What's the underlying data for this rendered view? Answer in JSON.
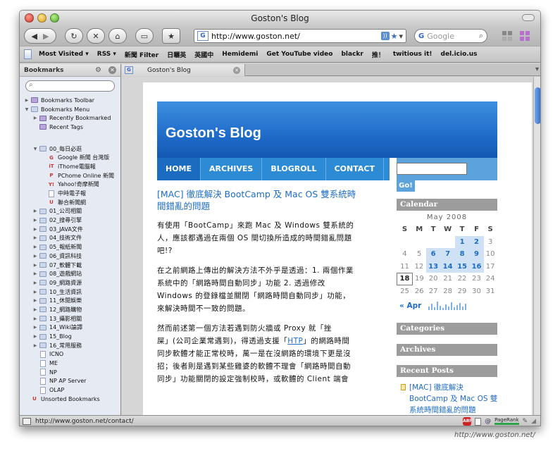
{
  "window": {
    "title": "Goston's Blog"
  },
  "nav": {
    "url": "http://www.goston.net/",
    "search_placeholder": "Google",
    "url_favicon": "G",
    "search_engine_icon": "G"
  },
  "bookmarks_toolbar": {
    "items": [
      "Most Visited ▾",
      "RSS ▾",
      "新聞 Filter",
      "日曬英",
      "英國中",
      "Hemidemi",
      "Get YouTube video",
      "blackr",
      "推！",
      "twitious it!",
      "del.icio.us"
    ]
  },
  "sidebar": {
    "header": "Bookmarks",
    "tree": [
      {
        "label": "Bookmarks Toolbar",
        "level": 0,
        "type": "folder-special",
        "state": "collapsed"
      },
      {
        "label": "Bookmarks Menu",
        "level": 0,
        "type": "folder",
        "state": "expanded"
      },
      {
        "label": "Recently Bookmarked",
        "level": 1,
        "type": "folder-special",
        "state": "collapsed"
      },
      {
        "label": "Recent Tags",
        "level": 1,
        "type": "folder-special",
        "state": "none"
      },
      {
        "label": "00_每日必逛",
        "level": 1,
        "type": "folder",
        "state": "expanded",
        "gap": true
      },
      {
        "label": "Google 新聞 台灣版",
        "level": 2,
        "type": "fav",
        "icon": "G"
      },
      {
        "label": "iThome電腦報",
        "level": 2,
        "type": "fav",
        "icon": "iT"
      },
      {
        "label": "PChome Online 新聞",
        "level": 2,
        "type": "fav",
        "icon": "P"
      },
      {
        "label": "Yahoo!奇摩新聞",
        "level": 2,
        "type": "fav",
        "icon": "Y!"
      },
      {
        "label": "中時電子報",
        "level": 2,
        "type": "doc"
      },
      {
        "label": "聯合新聞網",
        "level": 2,
        "type": "fav",
        "icon": "U"
      },
      {
        "label": "01_公司相關",
        "level": 1,
        "type": "folder",
        "state": "collapsed"
      },
      {
        "label": "02_搜尋引擎",
        "level": 1,
        "type": "folder",
        "state": "collapsed"
      },
      {
        "label": "03_JAVA文件",
        "level": 1,
        "type": "folder",
        "state": "collapsed"
      },
      {
        "label": "04_技術文件",
        "level": 1,
        "type": "folder",
        "state": "collapsed"
      },
      {
        "label": "05_報紙新聞",
        "level": 1,
        "type": "folder",
        "state": "collapsed"
      },
      {
        "label": "06_資訊科技",
        "level": 1,
        "type": "folder",
        "state": "collapsed"
      },
      {
        "label": "07_軟體下載",
        "level": 1,
        "type": "folder",
        "state": "collapsed"
      },
      {
        "label": "08_遊戲網站",
        "level": 1,
        "type": "folder",
        "state": "collapsed"
      },
      {
        "label": "09_網路資源",
        "level": 1,
        "type": "folder",
        "state": "collapsed"
      },
      {
        "label": "10_生活資訊",
        "level": 1,
        "type": "folder",
        "state": "collapsed"
      },
      {
        "label": "11_休閒娛樂",
        "level": 1,
        "type": "folder",
        "state": "collapsed"
      },
      {
        "label": "12_網路購物",
        "level": 1,
        "type": "folder",
        "state": "collapsed"
      },
      {
        "label": "13_攝影相關",
        "level": 1,
        "type": "folder",
        "state": "collapsed"
      },
      {
        "label": "14_Wiki論譚",
        "level": 1,
        "type": "folder",
        "state": "collapsed"
      },
      {
        "label": "15_Blog",
        "level": 1,
        "type": "folder",
        "state": "collapsed"
      },
      {
        "label": "16_常用服務",
        "level": 1,
        "type": "folder",
        "state": "collapsed"
      },
      {
        "label": "ICNO",
        "level": 1,
        "type": "doc"
      },
      {
        "label": "ME",
        "level": 1,
        "type": "doc"
      },
      {
        "label": "NP",
        "level": 1,
        "type": "doc"
      },
      {
        "label": "NP AP Server",
        "level": 1,
        "type": "doc"
      },
      {
        "label": "OLAP",
        "level": 1,
        "type": "doc"
      },
      {
        "label": "Unsorted Bookmarks",
        "level": 0,
        "type": "fav",
        "icon": "U"
      }
    ]
  },
  "tab": {
    "label": "Goston's Blog",
    "favicon": "G"
  },
  "status": {
    "url": "http://www.goston.net/contact/",
    "pagerank": "PageRank",
    "adblock_label": "ABP"
  },
  "watermark": "http://www.goston.net/",
  "blog": {
    "title": "Goston's Blog",
    "menu": [
      "HOME",
      "ARCHIVES",
      "BLOGROLL",
      "CONTACT"
    ],
    "go": "Go!",
    "post_title": [
      "[MAC] 徹底解決 BootCamp 及 Mac OS 雙系統時",
      "間錯亂的問題"
    ],
    "p1": [
      "有使用「BootCamp」來跑 Mac 及 Windows 雙系統的",
      "人，應該都遇過在兩個 OS 間切換所造成的時間錯亂問題",
      "吧!?"
    ],
    "p2": [
      "在之前網路上傳出的解決方法不外乎是透過：1. 兩個作業",
      "系統中的「網路時間自動同步」功能 2. 透過修改",
      "Windows 的登錄檔並關閉「網路時間自動同步」功能，",
      "來解決時間不一致的問題。"
    ],
    "p3_a": "然而前述第一個方法若遇到防火牆或 Proxy 就「挫",
    "p3_b1": "屎」(公司企業常遇到)，得透過支援「",
    "p3_link": "HTP",
    "p3_b2": "」的網路時間",
    "p3_rest": [
      "同步軟體才能正常校時，萬一是在沒網路的環境下更是沒",
      "招；後者則是遇到某些雞婆的軟體不理會「網路時間自動",
      "同步」功能關閉的設定強制校時，或軟體的 Client 端會"
    ],
    "calendar": {
      "heading": "Calendar",
      "month": "May 2008",
      "dow": [
        "S",
        "M",
        "T",
        "W",
        "T",
        "F",
        "S"
      ],
      "weeks": [
        [
          "",
          "",
          "",
          "",
          "1",
          "2",
          "3"
        ],
        [
          "4",
          "5",
          "6",
          "7",
          "8",
          "9",
          "10"
        ],
        [
          "11",
          "12",
          "13",
          "14",
          "15",
          "16",
          "17"
        ],
        [
          "18",
          "19",
          "20",
          "21",
          "22",
          "23",
          "24"
        ],
        [
          "25",
          "26",
          "27",
          "28",
          "29",
          "30",
          "31"
        ]
      ],
      "linked_days": [
        "1",
        "2",
        "6",
        "7",
        "8",
        "9",
        "13",
        "14",
        "15",
        "16"
      ],
      "today": "18",
      "prev": "« Apr"
    },
    "sidebar_headings": [
      "Categories",
      "Archives",
      "Recent Posts"
    ],
    "recent_post": [
      "[MAC] 徹底解決",
      "BootCamp 及 Mac OS 雙",
      "系統時間錯亂的問題"
    ]
  }
}
